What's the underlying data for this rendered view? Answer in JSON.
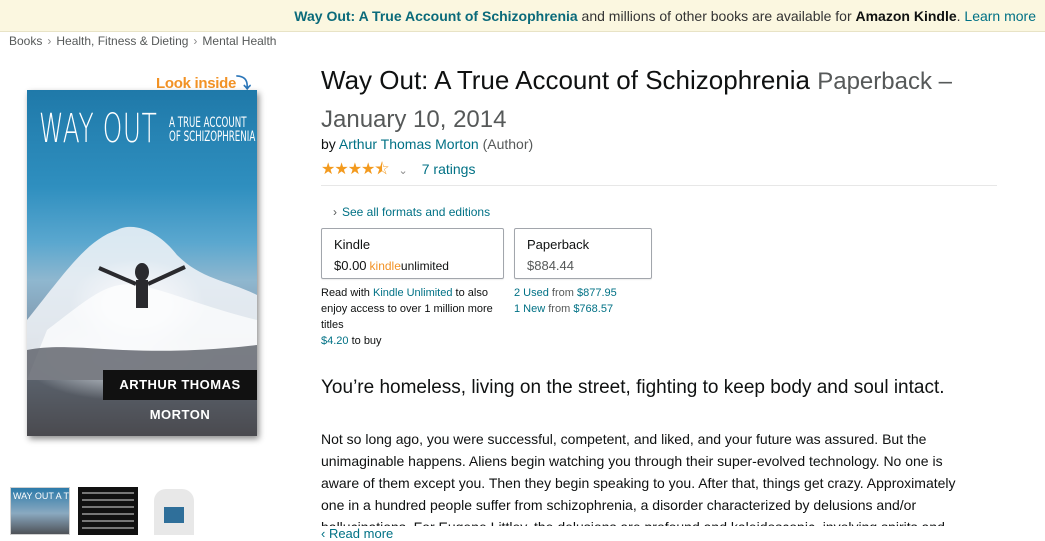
{
  "promo": {
    "book_link": "Way Out: A True Account of Schizophrenia",
    "middle_text": " and millions of other books are available for ",
    "kindle_text": "Amazon Kindle",
    "after_text": ". ",
    "learn_more": "Learn more"
  },
  "breadcrumb": [
    "Books",
    "Health, Fitness & Dieting",
    "Mental Health"
  ],
  "breadcrumb_sep": "›",
  "look_inside": {
    "label": "Look inside",
    "arrow": "⤵"
  },
  "cover": {
    "title": "WAY OUT",
    "subtitle_line1": "A TRUE ACCOUNT",
    "subtitle_line2": "OF SCHIZOPHRENIA",
    "author": "ARTHUR THOMAS MORTON"
  },
  "thumb1_text": "WAY OUT A TRUE ACCOUNT",
  "product": {
    "title": "Way Out: A True Account of Schizophrenia",
    "format_date": "Paperback – January 10, 2014",
    "by": "by ",
    "author": "Arthur Thomas Morton",
    "role": "(Author)",
    "rating": 4.5,
    "stars": "★★★★⯪",
    "ratings_count": "7 ratings",
    "chevron": "⌄"
  },
  "formats": {
    "see_all": "See all formats and editions",
    "see_all_gt": "›",
    "kindle": {
      "name": "Kindle",
      "price": "$0.00",
      "ku_part1": "kindle",
      "ku_part2": "unlimited"
    },
    "paperback": {
      "name": "Paperback",
      "price": "$884.44"
    },
    "ku_note": {
      "t1": "Read with ",
      "link": "Kindle Unlimited",
      "t2": " to also enjoy access to over 1 million more titles",
      "buy_price": "$4.20",
      "buy_text": " to buy"
    },
    "used": {
      "link": "2 Used",
      "from": " from ",
      "price": "$877.95"
    },
    "new": {
      "link": "1 New",
      "from": " from ",
      "price": "$768.57"
    }
  },
  "description": {
    "headline": "You’re homeless, living on the street, fighting to keep body and soul intact.",
    "body": "Not so long ago, you were successful, competent, and liked, and your future was assured. But the unimaginable happens. Aliens begin watching you through their super-evolved technology. No one is aware of them except you. Then they begin speaking to you. After that, things get crazy. Approximately one in a hundred people suffer from schizophrenia, a disorder characterized by delusions and/or hallucinations. For Eugene Littley, the delusions are profound and kaleidoscopic, involving spirits and",
    "read_more": "‹ Read more"
  }
}
